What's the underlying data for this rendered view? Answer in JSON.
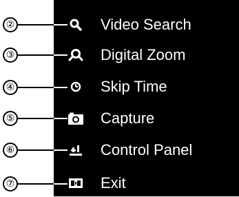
{
  "callouts": [
    "②",
    "③",
    "④",
    "⑤",
    "⑥",
    "⑦"
  ],
  "menu": {
    "items": [
      {
        "label": "Video Search",
        "icon": "search-icon"
      },
      {
        "label": "Digital Zoom",
        "icon": "zoom-icon"
      },
      {
        "label": "Skip Time",
        "icon": "clock-icon"
      },
      {
        "label": "Capture",
        "icon": "camera-icon"
      },
      {
        "label": "Control Panel",
        "icon": "control-panel-icon"
      },
      {
        "label": "Exit",
        "icon": "exit-icon"
      }
    ]
  },
  "colors": {
    "panel_background": "#000000",
    "text": "#ffffff",
    "callout_line": "#000000"
  }
}
